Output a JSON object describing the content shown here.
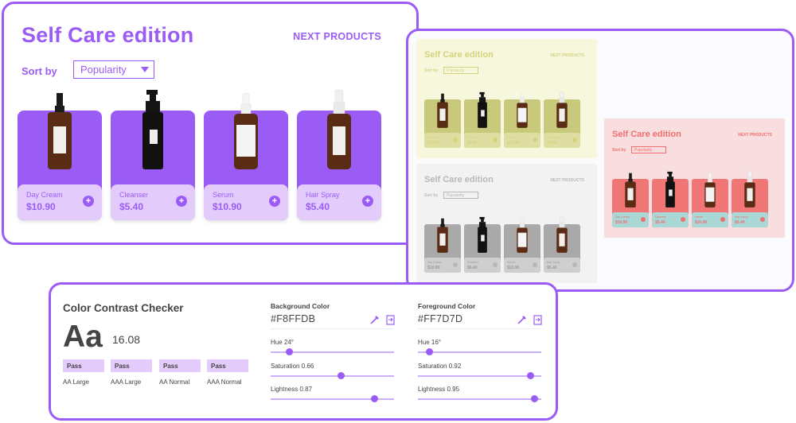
{
  "main": {
    "title": "Self Care edition",
    "next": "NEXT PRODUCTS",
    "sort_label": "Sort by",
    "sort_value": "Popularity",
    "products": [
      {
        "name": "Day Cream",
        "price": "$10.90",
        "plus": "+"
      },
      {
        "name": "Cleanser",
        "price": "$5.40",
        "plus": "+"
      },
      {
        "name": "Serum",
        "price": "$10.90",
        "plus": "+"
      },
      {
        "name": "Hair Spray",
        "price": "$5.40",
        "plus": "+"
      }
    ]
  },
  "variants": [
    {
      "theme": "green",
      "title": "Self Care edition",
      "next": "NEXT PRODUCTS",
      "sort_label": "Sort by",
      "sort_value": "Popularity",
      "products": [
        {
          "name": "Day Cream",
          "price": "$10.90"
        },
        {
          "name": "Cleanser",
          "price": "$5.40"
        },
        {
          "name": "Serum",
          "price": "$10.90"
        },
        {
          "name": "Hair Spray",
          "price": "$5.40"
        }
      ]
    },
    {
      "theme": "gray",
      "title": "Self Care edition",
      "next": "NEXT PRODUCTS",
      "sort_label": "Sort by",
      "sort_value": "Popularity",
      "products": [
        {
          "name": "Day Cream",
          "price": "$10.90"
        },
        {
          "name": "Cleanser",
          "price": "$5.40"
        },
        {
          "name": "Serum",
          "price": "$10.90"
        },
        {
          "name": "Hair Spray",
          "price": "$5.40"
        }
      ]
    },
    {
      "theme": "coral",
      "title": "Self Care edition",
      "next": "NEXT PRODUCTS",
      "sort_label": "Sort by",
      "sort_value": "Popularity",
      "products": [
        {
          "name": "Day Cream",
          "price": "$10.90"
        },
        {
          "name": "Cleanser",
          "price": "$5.40"
        },
        {
          "name": "Serum",
          "price": "$10.90"
        },
        {
          "name": "Hair Spray",
          "price": "$5.40"
        }
      ]
    }
  ],
  "themes": {
    "green": {
      "bg": "#f6f7dc",
      "accent": "#d3d37e",
      "card": "#c8c97a",
      "info": "#dedea3",
      "text": "#d3d37e"
    },
    "gray": {
      "bg": "#f2f2f2",
      "accent": "#b7b7b7",
      "card": "#a9a9a9",
      "info": "#cfcfcf",
      "text": "#9a9a9a"
    },
    "coral": {
      "bg": "#f8dedf",
      "accent": "#f16e6e",
      "card": "#f17676",
      "info": "#a9d8d7",
      "text": "#f16e6e"
    }
  },
  "checker": {
    "title": "Color Contrast Checker",
    "sample": "Aa",
    "ratio": "16.08",
    "results": [
      {
        "status": "Pass",
        "label": "AA Large"
      },
      {
        "status": "Pass",
        "label": "AAA Large"
      },
      {
        "status": "Pass",
        "label": "AA Normal"
      },
      {
        "status": "Pass",
        "label": "AAA Normal"
      }
    ],
    "background": {
      "label": "Background Color",
      "hex": "#F8FFDB",
      "hue_label": "Hue 24°",
      "hue": 0.15,
      "sat_label": "Saturation 0.66",
      "sat": 0.57,
      "light_label": "Lightness 0.87",
      "light": 0.84
    },
    "foreground": {
      "label": "Foreground Color",
      "hex": "#FF7D7D",
      "hue_label": "Hue 16°",
      "hue": 0.09,
      "sat_label": "Saturation 0.92",
      "sat": 0.91,
      "light_label": "Lightness 0.95",
      "light": 0.94
    }
  },
  "colors": {
    "brand": "#9b5cf6",
    "brand_light": "#e3ccfb",
    "text_dark": "#444444"
  }
}
